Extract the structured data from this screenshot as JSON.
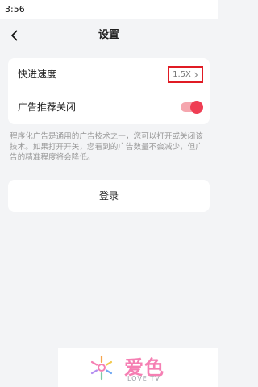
{
  "status_bar": {
    "time": "3:56"
  },
  "header": {
    "title": "设置"
  },
  "settings": {
    "speed_label": "快进速度",
    "speed_value": "1.5X",
    "ads_label": "广告推荐关闭",
    "ads_toggle_on": true
  },
  "description": "程序化广告是通用的广告技术之一，您可以打开或关闭该技术。如果打开开关，您看到的广告数量不会减少，但广告的精准程度将会降低。",
  "login_label": "登录",
  "watermark": {
    "title": "爱色",
    "subtitle": "LOVE TV"
  },
  "colors": {
    "accent": "#ef3e54",
    "highlight_box": "#e01b24"
  }
}
